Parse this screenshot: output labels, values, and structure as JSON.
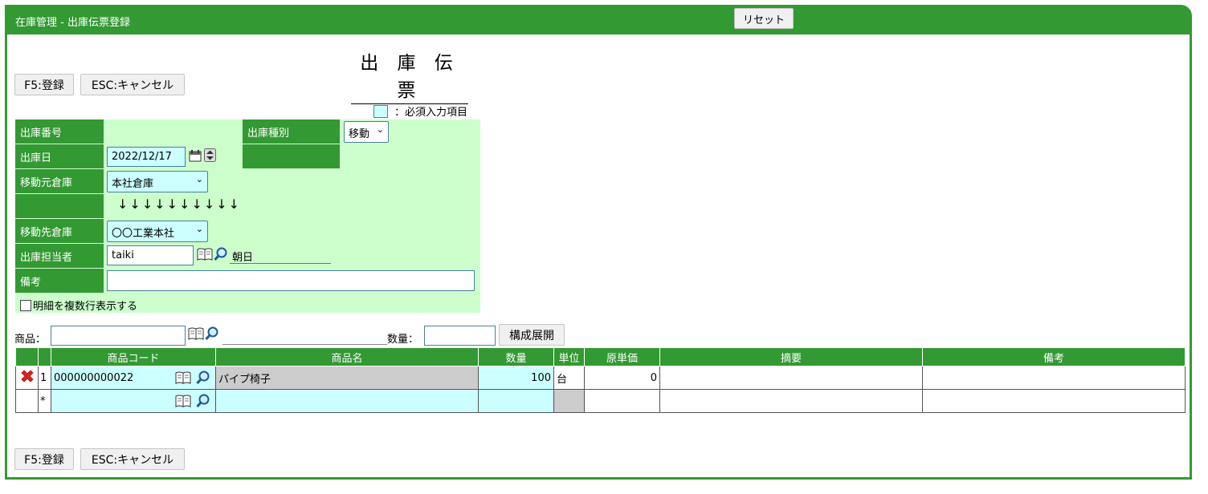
{
  "window": {
    "title": "在庫管理 - 出庫伝票登録",
    "reset_label": "リセット"
  },
  "page_heading": "出 庫 伝 票",
  "toolbar": {
    "register_label": "F5:登録",
    "cancel_label": "ESC:キャンセル"
  },
  "legend": {
    "required_text": "：必須入力項目"
  },
  "form": {
    "slip_number_label": "出庫番号",
    "slip_number_value": "",
    "issue_type_label": "出庫種別",
    "issue_type_value": "移動",
    "issue_date_label": "出庫日",
    "issue_date_value": "2022/12/17",
    "source_warehouse_label": "移動元倉庫",
    "source_warehouse_value": "本社倉庫",
    "arrows": "↓↓↓↓↓↓↓↓↓↓",
    "dest_warehouse_label": "移動先倉庫",
    "dest_warehouse_value": "〇〇工業本社",
    "staff_label": "出庫担当者",
    "staff_code": "taiki",
    "staff_name": "朝日",
    "remarks_label": "備考",
    "remarks_value": "",
    "multiline_checkbox_label": "明細を複数行表示する"
  },
  "product_search": {
    "product_label": "商品：",
    "product_value": "",
    "quantity_label": "数量：",
    "quantity_value": "",
    "expand_label": "構成展開"
  },
  "table": {
    "headers": {
      "product_code": "商品コード",
      "product_name": "商品名",
      "quantity": "数量",
      "unit": "単位",
      "unit_cost": "原単価",
      "summary": "摘要",
      "remarks": "備考"
    },
    "rows": [
      {
        "line_no": "1",
        "product_code": "000000000022",
        "product_name": "パイプ椅子",
        "quantity": "100",
        "unit": "台",
        "unit_cost": "0",
        "summary": "",
        "remarks": ""
      },
      {
        "line_no": "*",
        "product_code": "",
        "product_name": "",
        "quantity": "",
        "unit": "",
        "unit_cost": "",
        "summary": "",
        "remarks": ""
      }
    ]
  },
  "colors": {
    "header_green": "#339933",
    "form_bg": "#ccffcc",
    "required_bg": "#ccffff",
    "readonly_gray": "#cccccc",
    "delete_red": "#e02020"
  }
}
